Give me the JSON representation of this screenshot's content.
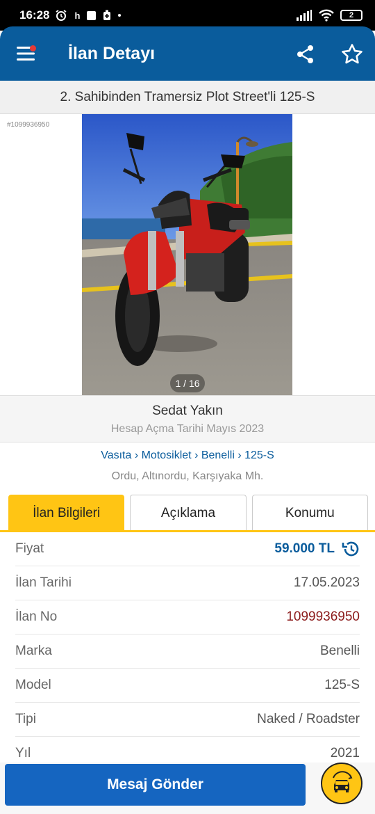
{
  "status_bar": {
    "time": "16:28",
    "notif_letter": "h",
    "battery": "2"
  },
  "app_bar": {
    "title": "İlan Detayı"
  },
  "listing": {
    "title": "2. Sahibinden Tramersiz Plot Street'li 125-S",
    "id_tag": "#1099936950",
    "photo_counter": "1 / 16"
  },
  "seller": {
    "name": "Sedat Yakın",
    "since": "Hesap Açma Tarihi  Mayıs 2023"
  },
  "breadcrumb": "Vasıta › Motosiklet › Benelli › 125-S",
  "location": "Ordu, Altınordu, Karşıyaka Mh.",
  "tabs": [
    {
      "label": "İlan Bilgileri",
      "active": true
    },
    {
      "label": "Açıklama",
      "active": false
    },
    {
      "label": "Konumu",
      "active": false
    }
  ],
  "info": [
    {
      "label": "Fiyat",
      "value": "59.000 TL"
    },
    {
      "label": "İlan Tarihi",
      "value": "17.05.2023"
    },
    {
      "label": "İlan No",
      "value": "1099936950"
    },
    {
      "label": "Marka",
      "value": "Benelli"
    },
    {
      "label": "Model",
      "value": "125-S"
    },
    {
      "label": "Tipi",
      "value": "Naked / Roadster"
    },
    {
      "label": "Yıl",
      "value": "2021"
    }
  ],
  "bottom": {
    "message_button": "Mesaj Gönder"
  },
  "colors": {
    "primary": "#0a5c9c",
    "accent": "#ffc514",
    "button": "#1565c0",
    "adno": "#8b1a1a"
  }
}
